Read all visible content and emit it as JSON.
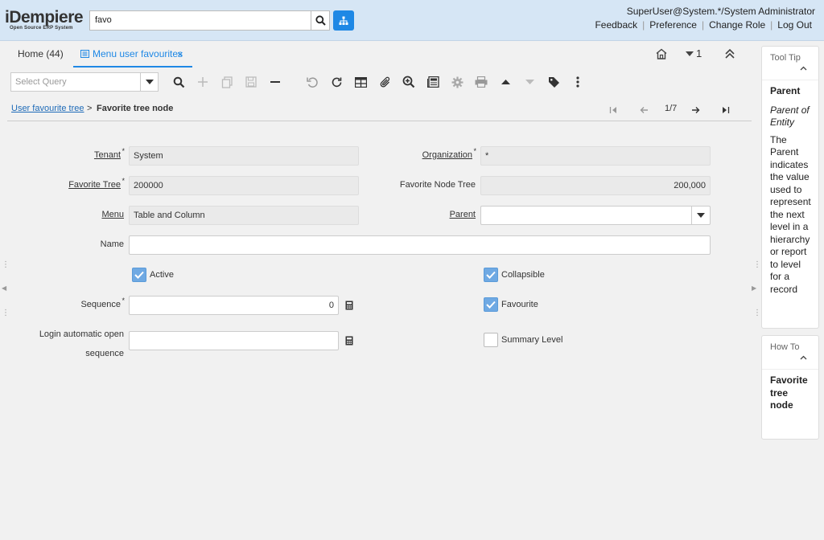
{
  "header": {
    "logo_main": "iDempiere",
    "logo_sub": "Open Source ERP System",
    "search_value": "favo",
    "user": "SuperUser@System.*/System Administrator",
    "links": [
      "Feedback",
      "Preference",
      "Change Role",
      "Log Out"
    ]
  },
  "tabs": {
    "home": "Home (44)",
    "active": "Menu user favourites",
    "badge_count": "1"
  },
  "toolbar": {
    "query_placeholder": "Select Query"
  },
  "breadcrumb": {
    "parent": "User favourite tree",
    "sep": ">",
    "current": "Favorite tree node",
    "record_count": "1/7"
  },
  "form": {
    "tenant_label": "Tenant",
    "tenant_value": "System",
    "org_label": "Organization",
    "org_value": "*",
    "fav_tree_label": "Favorite Tree",
    "fav_tree_value": "200000",
    "fav_node_tree_label": "Favorite Node Tree",
    "fav_node_tree_value": "200,000",
    "menu_label": "Menu",
    "menu_value": "Table and Column",
    "parent_label": "Parent",
    "parent_value": "",
    "name_label": "Name",
    "name_value": "",
    "active_label": "Active",
    "active_checked": true,
    "collapsible_label": "Collapsible",
    "collapsible_checked": true,
    "sequence_label": "Sequence",
    "sequence_value": "0",
    "favourite_label": "Favourite",
    "favourite_checked": true,
    "login_label_1": "Login automatic open",
    "login_label_2": "sequence",
    "login_value": "",
    "summary_label": "Summary Level",
    "summary_checked": false
  },
  "panel": {
    "tooltip_title": "Tool Tip",
    "tooltip_heading": "Parent",
    "tooltip_italic": "Parent of Entity",
    "tooltip_text": "The Parent indicates the value used to represent the next level in a hierarchy or report to level for a record",
    "howto_title": "How To",
    "howto_heading": "Favorite tree node"
  },
  "colors": {
    "accent": "#1e88e5",
    "header_bg": "#d6e6f5",
    "checkbox_on": "#6fa9e3"
  }
}
